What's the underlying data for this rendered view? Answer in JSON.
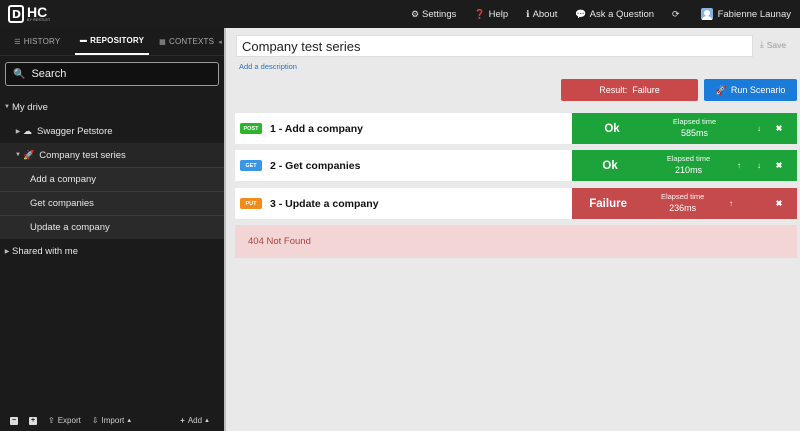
{
  "app": {
    "logo_text": "HC",
    "logo_by": "BY RESTLET"
  },
  "topnav": {
    "settings": "Settings",
    "help": "Help",
    "about": "About",
    "ask": "Ask a Question",
    "user": "Fabienne Launay"
  },
  "sidebar": {
    "tabs": [
      {
        "label": "HISTORY"
      },
      {
        "label": "REPOSITORY"
      },
      {
        "label": "CONTEXTS"
      }
    ],
    "search_label": "Search",
    "tree": {
      "my_drive": "My drive",
      "swagger": "Swagger Petstore",
      "company_series": "Company test series",
      "requests": [
        "Add a company",
        "Get companies",
        "Update a company"
      ],
      "shared": "Shared with me"
    },
    "bottom": {
      "export": "Export",
      "import": "Import",
      "add": "Add"
    }
  },
  "main": {
    "title": "Company test series",
    "save": "Save",
    "add_description": "Add a description",
    "result_label": "Result:",
    "result_value": "Failure",
    "run_label": "Run Scenario",
    "elapsed_label": "Elapsed time",
    "requests": [
      {
        "method": "POST",
        "name": "1 - Add a company",
        "result": "Ok",
        "time": "585ms"
      },
      {
        "method": "GET",
        "name": "2 - Get companies",
        "result": "Ok",
        "time": "210ms"
      },
      {
        "method": "PUT",
        "name": "3 - Update a company",
        "result": "Failure",
        "time": "236ms"
      }
    ],
    "error": "404 Not Found"
  },
  "colors": {
    "post": "#2ab52a",
    "get": "#3a95e4",
    "put": "#f08c1b",
    "ok": "#1ca33a",
    "failure": "#c44a4b",
    "run": "#1a7bd9"
  }
}
